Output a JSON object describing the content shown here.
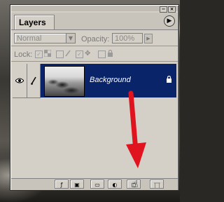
{
  "panel": {
    "tab_label": "Layers",
    "close_glyph": "×",
    "minimize_glyph": "−",
    "menu_glyph": "▶"
  },
  "options": {
    "blend_mode": "Normal",
    "blend_arrow": "▼",
    "opacity_label": "Opacity:",
    "opacity_value": "100%",
    "opacity_arrow": "▶"
  },
  "lock": {
    "label": "Lock:",
    "transparency_glyph": "✓",
    "image_glyph": "✓",
    "position_glyph": "✥",
    "all_glyph": "🔒"
  },
  "layers": [
    {
      "name": "Background",
      "visible_glyph": "👁",
      "brush_glyph": "✎",
      "lock_glyph": "🔒"
    }
  ],
  "bottom_bar": {
    "buttons": [
      {
        "icon": "layer-style-icon",
        "glyph": "ƒ"
      },
      {
        "icon": "add-mask-icon",
        "glyph": "▣"
      },
      {
        "icon": "new-set-icon",
        "glyph": "▭"
      },
      {
        "icon": "adjustment-layer-icon",
        "glyph": "◐"
      },
      {
        "icon": "new-layer-icon",
        "glyph": "◻"
      },
      {
        "icon": "delete-layer-icon",
        "glyph": "🗑"
      }
    ]
  },
  "colors": {
    "selection": "#0a246a",
    "annotation_arrow": "#e0141e"
  }
}
